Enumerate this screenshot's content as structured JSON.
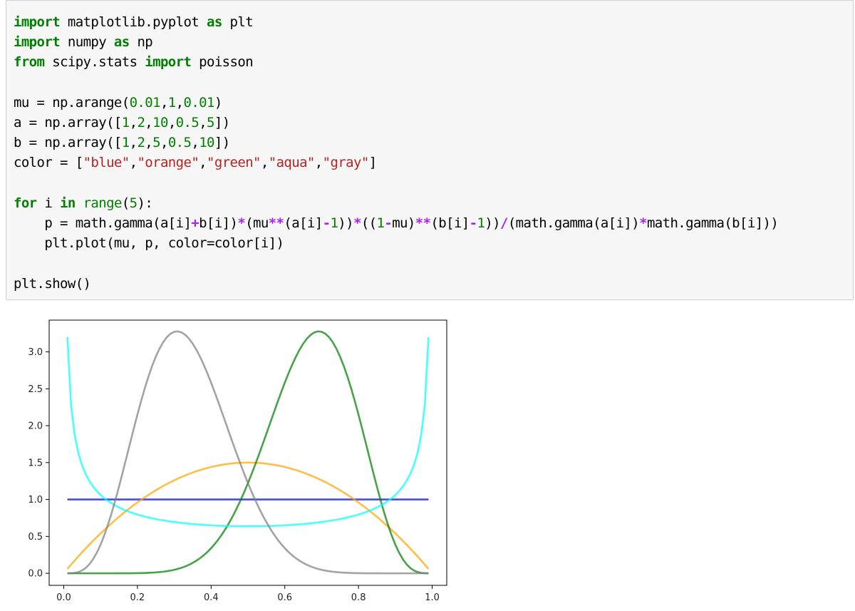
{
  "code_cell": {
    "lines": [
      [
        [
          "kw",
          "import"
        ],
        [
          "t",
          " matplotlib.pyplot "
        ],
        [
          "kw",
          "as"
        ],
        [
          "t",
          " plt"
        ]
      ],
      [
        [
          "kw",
          "import"
        ],
        [
          "t",
          " numpy "
        ],
        [
          "kw",
          "as"
        ],
        [
          "t",
          " np"
        ]
      ],
      [
        [
          "kw",
          "from"
        ],
        [
          "t",
          " scipy.stats "
        ],
        [
          "kw",
          "import"
        ],
        [
          "t",
          " poisson"
        ]
      ],
      [],
      [
        [
          "t",
          "mu = np.arange("
        ],
        [
          "num",
          "0.01"
        ],
        [
          "t",
          ","
        ],
        [
          "num",
          "1"
        ],
        [
          "t",
          ","
        ],
        [
          "num",
          "0.01"
        ],
        [
          "t",
          ")"
        ]
      ],
      [
        [
          "t",
          "a = np.array(["
        ],
        [
          "num",
          "1"
        ],
        [
          "t",
          ","
        ],
        [
          "num",
          "2"
        ],
        [
          "t",
          ","
        ],
        [
          "num",
          "10"
        ],
        [
          "t",
          ","
        ],
        [
          "num",
          "0.5"
        ],
        [
          "t",
          ","
        ],
        [
          "num",
          "5"
        ],
        [
          "t",
          "])"
        ]
      ],
      [
        [
          "t",
          "b = np.array(["
        ],
        [
          "num",
          "1"
        ],
        [
          "t",
          ","
        ],
        [
          "num",
          "2"
        ],
        [
          "t",
          ","
        ],
        [
          "num",
          "5"
        ],
        [
          "t",
          ","
        ],
        [
          "num",
          "0.5"
        ],
        [
          "t",
          ","
        ],
        [
          "num",
          "10"
        ],
        [
          "t",
          "])"
        ]
      ],
      [
        [
          "t",
          "color = ["
        ],
        [
          "str",
          "\"blue\""
        ],
        [
          "t",
          ","
        ],
        [
          "str",
          "\"orange\""
        ],
        [
          "t",
          ","
        ],
        [
          "str",
          "\"green\""
        ],
        [
          "t",
          ","
        ],
        [
          "str",
          "\"aqua\""
        ],
        [
          "t",
          ","
        ],
        [
          "str",
          "\"gray\""
        ],
        [
          "t",
          "]"
        ]
      ],
      [],
      [
        [
          "kw",
          "for"
        ],
        [
          "t",
          " i "
        ],
        [
          "kw",
          "in"
        ],
        [
          "t",
          " "
        ],
        [
          "bi",
          "range"
        ],
        [
          "t",
          "("
        ],
        [
          "num",
          "5"
        ],
        [
          "t",
          "):"
        ]
      ],
      [
        [
          "t",
          "    p = math.gamma(a[i]"
        ],
        [
          "op",
          "+"
        ],
        [
          "t",
          "b[i])"
        ],
        [
          "op",
          "*"
        ],
        [
          "t",
          "(mu"
        ],
        [
          "op",
          "**"
        ],
        [
          "t",
          "(a[i]"
        ],
        [
          "op",
          "-"
        ],
        [
          "num",
          "1"
        ],
        [
          "t",
          "))"
        ],
        [
          "op",
          "*"
        ],
        [
          "t",
          "(("
        ],
        [
          "num",
          "1"
        ],
        [
          "op",
          "-"
        ],
        [
          "t",
          "mu)"
        ],
        [
          "op",
          "**"
        ],
        [
          "t",
          "(b[i]"
        ],
        [
          "op",
          "-"
        ],
        [
          "num",
          "1"
        ],
        [
          "t",
          "))"
        ],
        [
          "op",
          "/"
        ],
        [
          "t",
          "(math.gamma(a[i])"
        ],
        [
          "op",
          "*"
        ],
        [
          "t",
          "math.gamma(b[i]))"
        ]
      ],
      [
        [
          "t",
          "    plt.plot(mu, p, color=color[i])"
        ]
      ],
      [],
      [
        [
          "t",
          "plt.show()"
        ]
      ]
    ]
  },
  "chart_data": {
    "type": "line",
    "xlim": [
      -0.0395,
      1.0395
    ],
    "ylim": [
      -0.163,
      3.43
    ],
    "xticks": [
      0.0,
      0.2,
      0.4,
      0.6,
      0.8,
      1.0
    ],
    "xtick_labels": [
      "0.0",
      "0.2",
      "0.4",
      "0.6",
      "0.8",
      "1.0"
    ],
    "yticks": [
      0.0,
      0.5,
      1.0,
      1.5,
      2.0,
      2.5,
      3.0
    ],
    "ytick_labels": [
      "0.0",
      "0.5",
      "1.0",
      "1.5",
      "2.0",
      "2.5",
      "3.0"
    ],
    "grid": false,
    "x": {
      "start": 0.01,
      "stop": 1.0,
      "step": 0.01
    },
    "series": [
      {
        "a": 1,
        "b": 1,
        "color": "#0000ff"
      },
      {
        "a": 2,
        "b": 2,
        "color": "#ffa500"
      },
      {
        "a": 10,
        "b": 5,
        "color": "#008000"
      },
      {
        "a": 0.5,
        "b": 0.5,
        "color": "#00ffff"
      },
      {
        "a": 5,
        "b": 10,
        "color": "#808080"
      }
    ]
  }
}
